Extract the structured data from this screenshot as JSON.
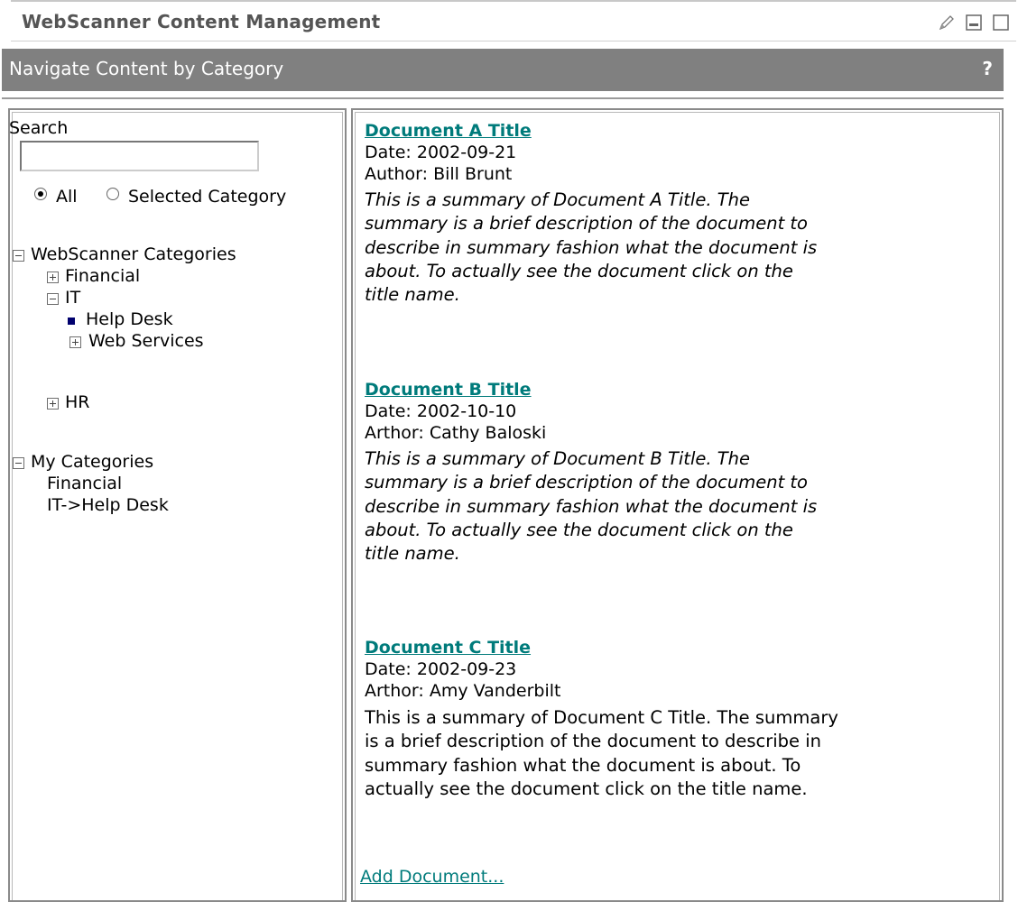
{
  "portlet": {
    "title": "WebScanner Content Management",
    "icons": [
      "pencil-icon",
      "minimize-icon",
      "maximize-icon"
    ]
  },
  "nav": {
    "title": "Navigate Content by Category",
    "help": "?"
  },
  "search": {
    "label": "Search",
    "value": "",
    "scope_options": [
      {
        "label": "All",
        "selected": true
      },
      {
        "label": "Selected Category",
        "selected": false
      }
    ]
  },
  "tree": {
    "webscanner_categories": {
      "label": "WebScanner Categories",
      "expanded": true,
      "children": [
        {
          "label": "Financial",
          "expanded": false
        },
        {
          "label": "IT",
          "expanded": true,
          "children": [
            {
              "label": "Help Desk",
              "selected": true
            },
            {
              "label": "Web Services",
              "expanded": false
            }
          ]
        },
        {
          "label": "HR",
          "expanded": false
        }
      ]
    },
    "my_categories": {
      "label": "My Categories",
      "expanded": true,
      "items": [
        "Financial",
        "IT->Help Desk"
      ]
    }
  },
  "documents": [
    {
      "title": "Document A Title",
      "date": "Date: 2002-09-21",
      "author": "Author: Bill Brunt",
      "summary_lines": [
        "This is a summary of Document A Title.  The",
        "summary is a brief description of the document to",
        "describe in summary fashion what the document is",
        "about.  To actually see the document click on the",
        "title name."
      ]
    },
    {
      "title": "Document B Title",
      "date": "Date: 2002-10-10",
      "author": "Arthor: Cathy Baloski",
      "summary_lines": [
        "This is a summary of Document B Title.  The",
        "summary is a brief description of the document to",
        "describe in summary fashion what the document is",
        "about.  To actually see the document click on the",
        "title name."
      ]
    },
    {
      "title": "Document C Title",
      "date": "Date: 2002-09-23",
      "author": "Arthor: Amy Vanderbilt",
      "summary_lines": [
        "This is a summary of Document C Title.  The summary",
        "is a brief description of the document to describe in",
        "summary fashion what the document is about.  To",
        "actually see the document click on the title name."
      ]
    }
  ],
  "add_document": "Add Document..."
}
